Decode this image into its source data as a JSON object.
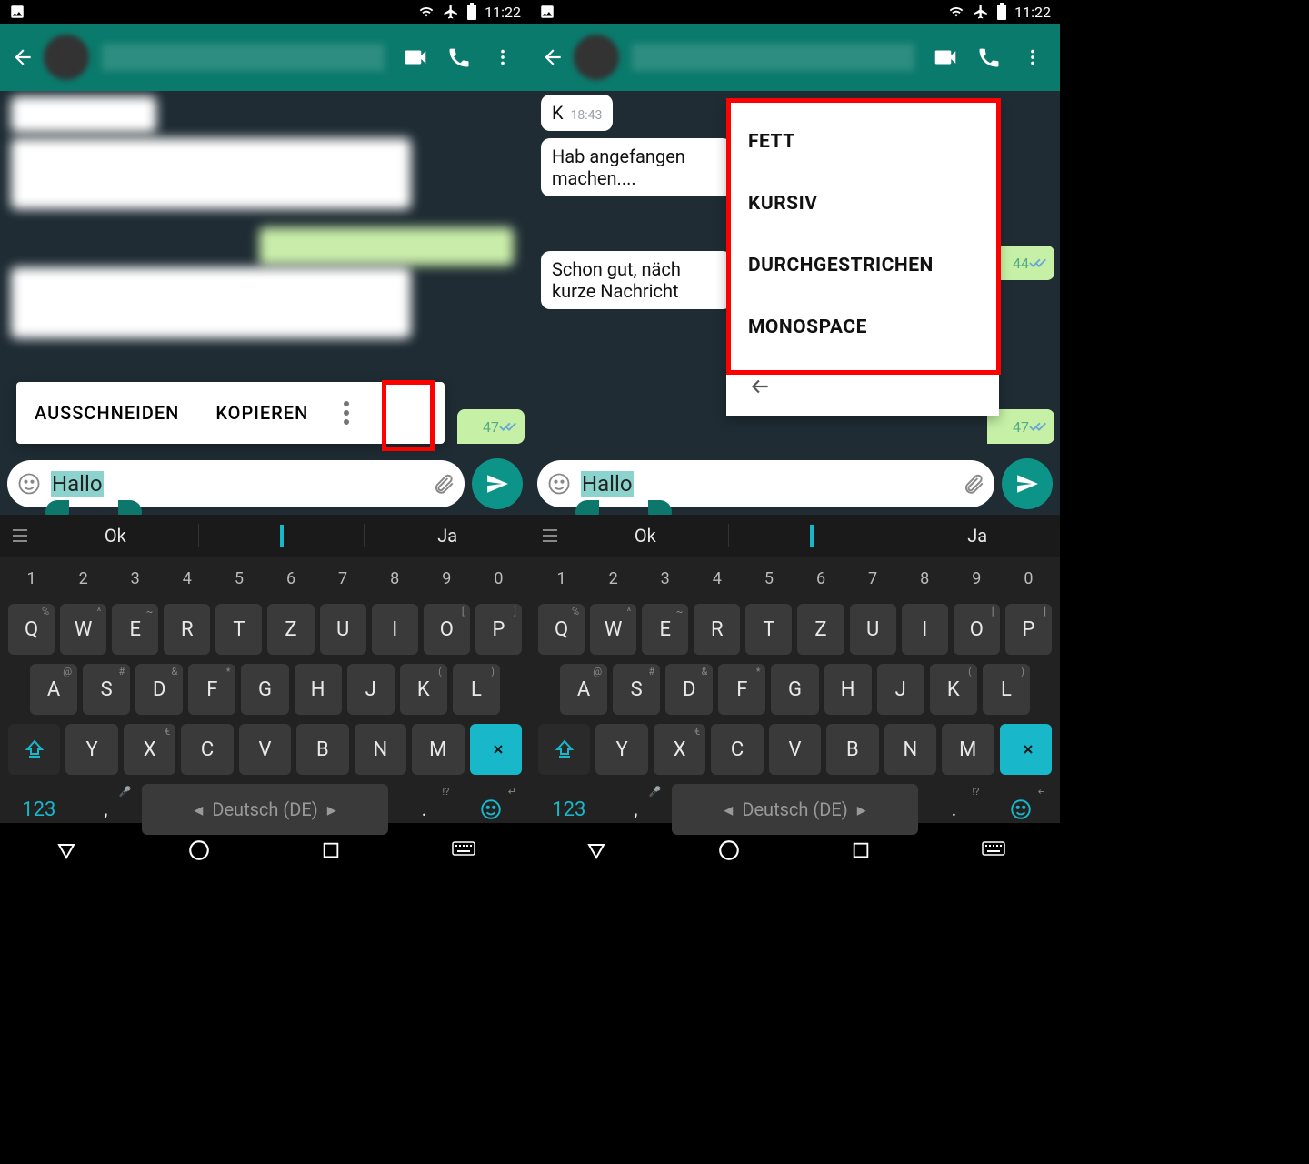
{
  "status": {
    "time": "11:22"
  },
  "left_screen": {
    "text_menu": {
      "cut": "AUSSCHNEIDEN",
      "copy": "KOPIEREN"
    },
    "input_text": "Hallo",
    "outgoing_peek": "47"
  },
  "right_screen": {
    "messages": {
      "m1_text": "K",
      "m1_time": "18:43",
      "m2_text": "Hab angefangen\nmachen....",
      "m3_text": "Schon gut, näch\nkurze Nachricht"
    },
    "peek1": "44",
    "peek2": "47",
    "format_menu": {
      "bold": "FETT",
      "italic": "KURSIV",
      "strike": "DURCHGESTRICHEN",
      "mono": "MONOSPACE"
    },
    "input_text": "Hallo"
  },
  "suggestions": {
    "left": "Ok",
    "right": "Ja"
  },
  "keyboard": {
    "numbers": [
      "1",
      "2",
      "3",
      "4",
      "5",
      "6",
      "7",
      "8",
      "9",
      "0"
    ],
    "row1": [
      "Q",
      "W",
      "E",
      "R",
      "T",
      "Z",
      "U",
      "I",
      "O",
      "P"
    ],
    "row1_alt": [
      "%",
      "^",
      "~",
      "",
      "",
      "",
      "",
      "",
      "[",
      "]"
    ],
    "row2": [
      "A",
      "S",
      "D",
      "F",
      "G",
      "H",
      "J",
      "K",
      "L"
    ],
    "row2_alt": [
      "@",
      "#",
      "&",
      "*",
      "",
      "",
      "",
      "(",
      ")"
    ],
    "row3": [
      "Y",
      "X",
      "C",
      "V",
      "B",
      "N",
      "M"
    ],
    "row3_alt": [
      "",
      "€",
      "",
      "",
      "",
      "",
      ""
    ],
    "num_key": "123",
    "space": "Deutsch (DE)",
    "period": ".",
    "period_alt": "!?",
    "comma": ",",
    "comma_alt": "🎤"
  }
}
